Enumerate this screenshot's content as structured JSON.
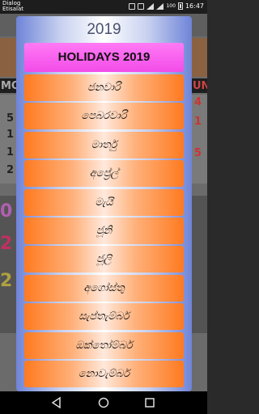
{
  "status_bar": {
    "carrier_line1": "Dialog",
    "carrier_line2": "Etisalat",
    "battery": "100",
    "time": "16:47"
  },
  "background": {
    "left_labels": [
      "MO",
      "5",
      "1",
      "1",
      "2"
    ],
    "right_labels": [
      "UN",
      "4",
      "1",
      "5"
    ],
    "big_left": [
      "0",
      "2",
      "2"
    ]
  },
  "dialog": {
    "year": "2019",
    "title": "HOLIDAYS 2019",
    "months": [
      "ජනවාරි",
      "පෙබරවාරි",
      "මාර්තු",
      "අප්‍රේල්",
      "මැයි",
      "ජූනි",
      "ජූලි",
      "අගෝස්තු",
      "සැප්තැම්බර්",
      "ඔක්තෝම්බර්",
      "නොවැම්බර්"
    ]
  },
  "colors": {
    "header_pink": "#f24ce8",
    "row_orange": "#ff7a20",
    "dialog_blue": "#6f84d8"
  }
}
